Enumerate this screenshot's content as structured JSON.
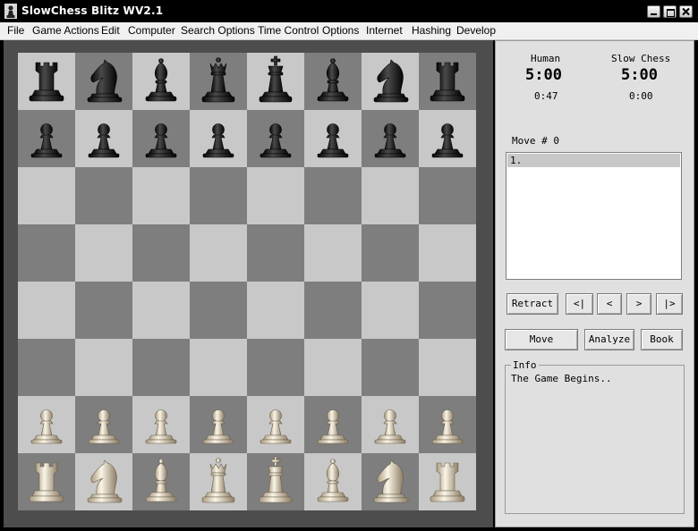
{
  "window": {
    "title": "SlowChess Blitz WV2.1"
  },
  "menu": [
    "File",
    "Game Actions",
    "Edit",
    "Computer",
    "Search Options",
    "Time Control",
    "Options",
    "Internet",
    "Hashing",
    "Develop"
  ],
  "board": {
    "ranks": [
      [
        "r",
        "n",
        "b",
        "q",
        "k",
        "b",
        "n",
        "r"
      ],
      [
        "p",
        "p",
        "p",
        "p",
        "p",
        "p",
        "p",
        "p"
      ],
      [
        "",
        "",
        "",
        "",
        "",
        "",
        "",
        ""
      ],
      [
        "",
        "",
        "",
        "",
        "",
        "",
        "",
        ""
      ],
      [
        "",
        "",
        "",
        "",
        "",
        "",
        "",
        ""
      ],
      [
        "",
        "",
        "",
        "",
        "",
        "",
        "",
        ""
      ],
      [
        "P",
        "P",
        "P",
        "P",
        "P",
        "P",
        "P",
        "P"
      ],
      [
        "R",
        "N",
        "B",
        "Q",
        "K",
        "B",
        "N",
        "R"
      ]
    ],
    "colors": {
      "light": "#c8c8c8",
      "dark": "#7e7e7e"
    }
  },
  "players": {
    "human": {
      "name": "Human",
      "clock": "5:00",
      "elapsed": "0:47"
    },
    "engine": {
      "name": "Slow Chess",
      "clock": "5:00",
      "elapsed": "0:00"
    }
  },
  "move_counter": "Move # 0",
  "move_list": [
    "1."
  ],
  "nav_buttons": {
    "retract": "Retract",
    "first": "<|",
    "prev": "<",
    "next": ">",
    "last": "|>"
  },
  "action_buttons": {
    "move": "Move",
    "analyze": "Analyze",
    "book": "Book"
  },
  "info": {
    "legend": "Info",
    "text": "The Game Begins.."
  }
}
